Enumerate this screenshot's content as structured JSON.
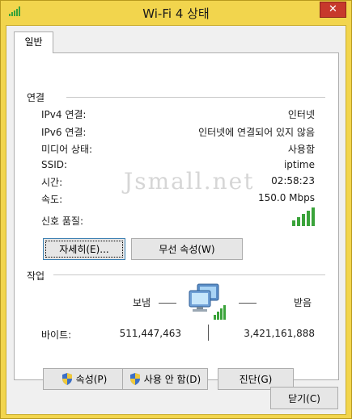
{
  "window": {
    "title": "Wi-Fi 4 상태",
    "close_label": "✕"
  },
  "tabs": [
    {
      "label": "일반"
    }
  ],
  "connection": {
    "section_title": "연결",
    "rows": [
      {
        "label": "IPv4 연결:",
        "value": "인터넷"
      },
      {
        "label": "IPv6 연결:",
        "value": "인터넷에 연결되어 있지 않음"
      },
      {
        "label": "미디어 상태:",
        "value": "사용함"
      },
      {
        "label": "SSID:",
        "value": "iptime"
      },
      {
        "label": "시간:",
        "value": "02:58:23"
      },
      {
        "label": "속도:",
        "value": "150.0 Mbps"
      }
    ],
    "signal_label": "신호 품질:",
    "signal_bars": 5
  },
  "watermark": "Jsmall.net",
  "buttons": {
    "details": "자세히(E)...",
    "wireless_props": "무선 속성(W)"
  },
  "activity": {
    "section_title": "작업",
    "sent_label": "보냄",
    "received_label": "받음",
    "bytes_label": "바이트:",
    "sent_value": "511,447,463",
    "received_value": "3,421,161,888"
  },
  "action_buttons": {
    "properties": "속성(P)",
    "disable": "사용 안 함(D)",
    "diagnose": "진단(G)"
  },
  "footer": {
    "close": "닫기(C)"
  },
  "colors": {
    "frame": "#f2d54d",
    "close_button": "#c7392c",
    "signal_green": "#3aa33a"
  }
}
